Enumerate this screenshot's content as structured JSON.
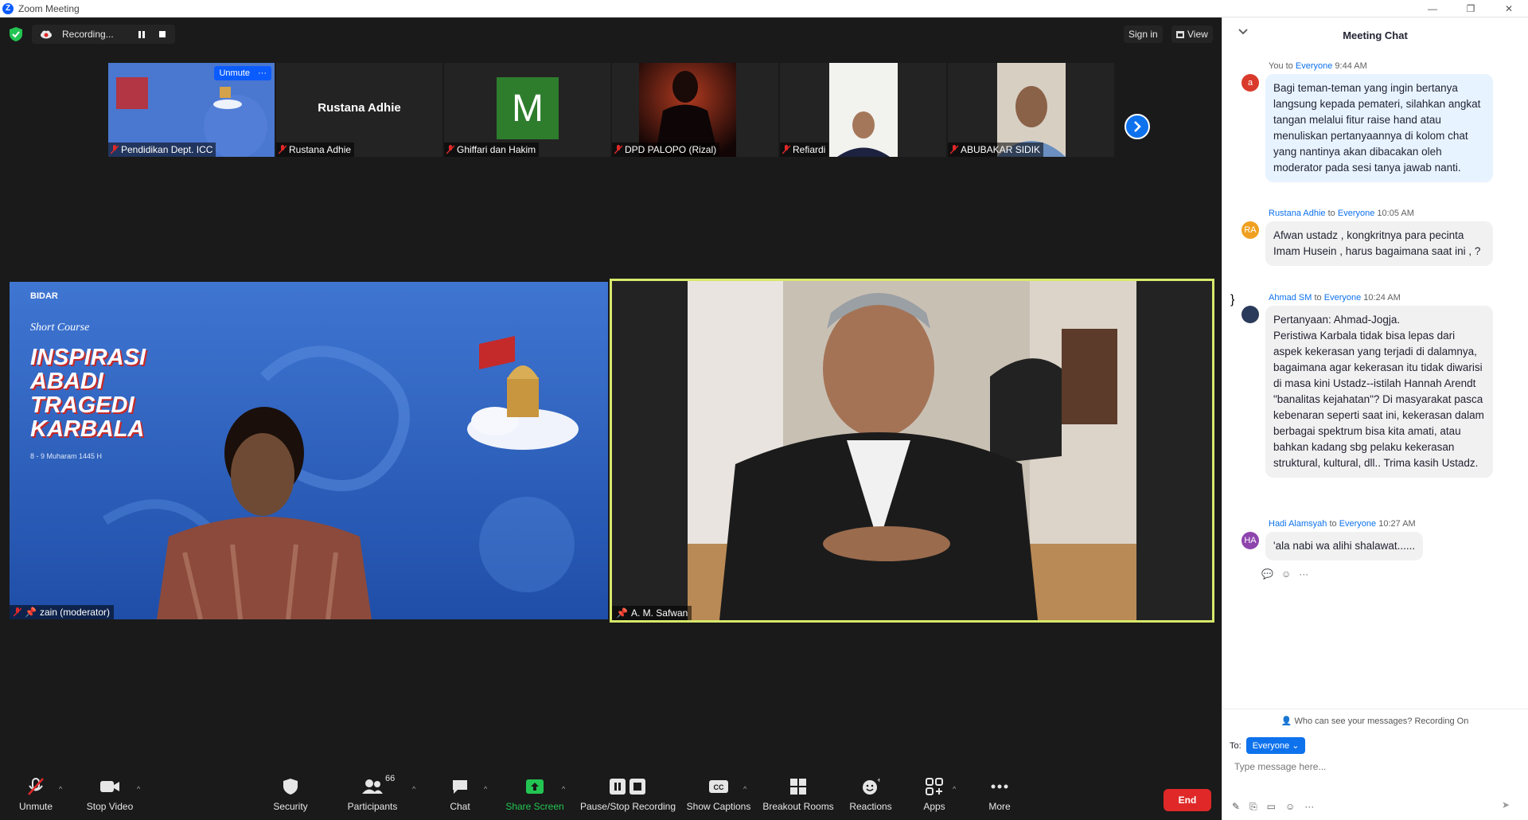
{
  "window": {
    "title": "Zoom Meeting",
    "controls": [
      "—",
      "❐",
      "✕"
    ]
  },
  "topbar": {
    "recording_label": "Recording...",
    "signin_label": "Sign in",
    "view_label": "View"
  },
  "thumbnails": [
    {
      "name": "Pendidikan Dept. ICC",
      "unmute_label": "Unmute",
      "more_label": "···"
    },
    {
      "name": "Rustana Adhie",
      "center_name": "Rustana Adhie"
    },
    {
      "name": "Ghiffari dan Hakim",
      "avatar_letter": "M"
    },
    {
      "name": "DPD PALOPO (Rizal)"
    },
    {
      "name": "Refiardi"
    },
    {
      "name": "ABUBAKAR SIDIK"
    }
  ],
  "main_videos": {
    "left": {
      "name": "zain (moderator)",
      "slide": {
        "org": "BIDAR",
        "subtitle": "Short Course",
        "title_lines": [
          "INSPIRASI",
          "ABADI",
          "TRAGEDI",
          "KARBALA"
        ],
        "date": "8 - 9 Muharam 1445 H"
      }
    },
    "right": {
      "name": "A. M. Safwan"
    }
  },
  "toolbar": {
    "items": [
      {
        "label": "Unmute"
      },
      {
        "label": "Stop Video"
      },
      {
        "label": "Security"
      },
      {
        "label": "Participants",
        "count": "66"
      },
      {
        "label": "Chat"
      },
      {
        "label": "Share Screen"
      },
      {
        "label": "Pause/Stop Recording"
      },
      {
        "label": "Show Captions"
      },
      {
        "label": "Breakout Rooms"
      },
      {
        "label": "Reactions"
      },
      {
        "label": "Apps"
      },
      {
        "label": "More"
      }
    ],
    "end_label": "End"
  },
  "chat": {
    "title": "Meeting Chat",
    "messages": [
      {
        "sender": "You",
        "to_word": "to",
        "recipient": "Everyone",
        "time": "9:44 AM",
        "avatar": "a",
        "avatar_color": "#d93a2b",
        "text": "Bagi teman-teman yang ingin bertanya langsung kepada pemateri, silahkan angkat tangan melalui fitur raise hand atau menuliskan pertanyaannya di kolom chat yang nantinya akan dibacakan oleh moderator pada sesi tanya jawab nanti."
      },
      {
        "sender": "Rustana Adhie",
        "to_word": "to",
        "recipient": "Everyone",
        "time": "10:05 AM",
        "avatar": "RA",
        "avatar_color": "#f0a020",
        "text": "Afwan ustadz , kongkritnya para pecinta Imam Husein , harus bagaimana saat ini , ?"
      },
      {
        "sender": "Ahmad SM",
        "to_word": "to",
        "recipient": "Everyone",
        "time": "10:24 AM",
        "avatar": "",
        "avatar_color": "#2a3a5a",
        "text": "Pertanyaan: Ahmad-Jogja.\nPeristiwa Karbala tidak bisa lepas dari aspek kekerasan yang terjadi di dalamnya, bagaimana agar kekerasan itu tidak diwarisi di masa kini Ustadz--istilah Hannah Arendt \"banalitas kejahatan\"? Di masyarakat pasca kebenaran seperti saat ini, kekerasan dalam berbagai spektrum bisa kita amati, atau bahkan kadang sbg pelaku kekerasan struktural, kultural, dll.. Trima kasih Ustadz."
      },
      {
        "sender": "Hadi Alamsyah",
        "to_word": "to",
        "recipient": "Everyone",
        "time": "10:27 AM",
        "avatar": "HA",
        "avatar_color": "#8e44ad",
        "text": "'ala nabi wa alihi shalawat......"
      }
    ],
    "who_can_see": "Who can see your messages? Recording On",
    "to_label": "To:",
    "recipient_button": "Everyone ⌄",
    "input_placeholder": "Type message here..."
  }
}
